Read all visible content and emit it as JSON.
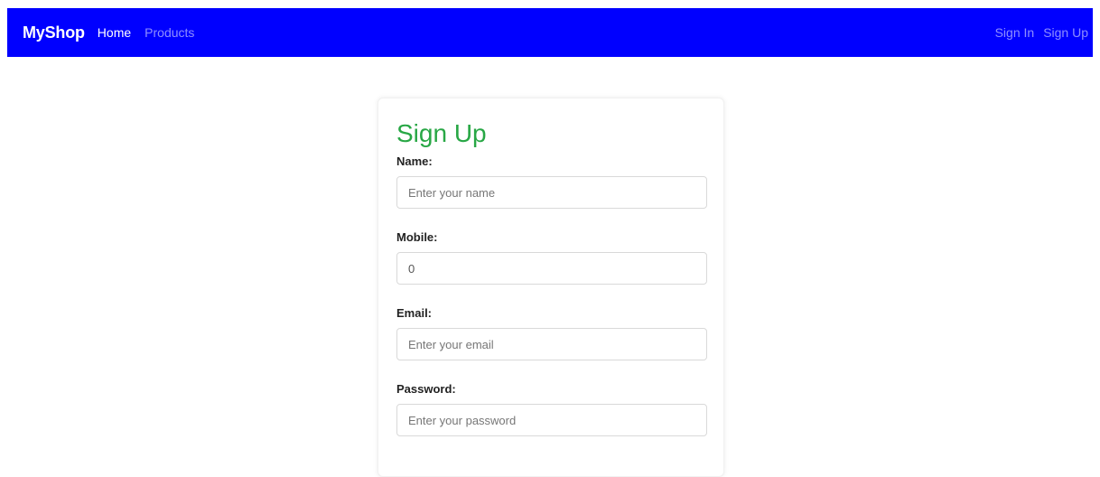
{
  "navbar": {
    "brand": "MyShop",
    "left_links": [
      {
        "label": "Home"
      },
      {
        "label": "Products"
      }
    ],
    "right_links": [
      {
        "label": "Sign In"
      },
      {
        "label": "Sign Up"
      }
    ],
    "background_color": "#0000ff"
  },
  "signup_form": {
    "title": "Sign Up",
    "title_color": "#28a745",
    "fields": {
      "name": {
        "label": "Name:",
        "placeholder": "Enter your name",
        "value": ""
      },
      "mobile": {
        "label": "Mobile:",
        "placeholder": "",
        "value": "0"
      },
      "email": {
        "label": "Email:",
        "placeholder": "Enter your email",
        "value": ""
      },
      "password": {
        "label": "Password:",
        "placeholder": "Enter your password",
        "value": ""
      }
    }
  }
}
